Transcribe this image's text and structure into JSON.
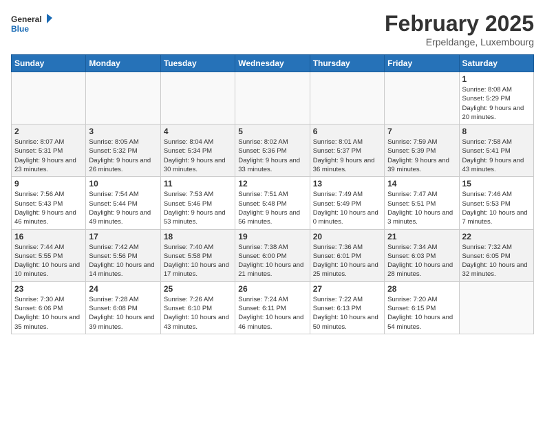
{
  "header": {
    "logo_general": "General",
    "logo_blue": "Blue",
    "month_title": "February 2025",
    "location": "Erpeldange, Luxembourg"
  },
  "weekdays": [
    "Sunday",
    "Monday",
    "Tuesday",
    "Wednesday",
    "Thursday",
    "Friday",
    "Saturday"
  ],
  "weeks": [
    [
      {
        "day": "",
        "info": ""
      },
      {
        "day": "",
        "info": ""
      },
      {
        "day": "",
        "info": ""
      },
      {
        "day": "",
        "info": ""
      },
      {
        "day": "",
        "info": ""
      },
      {
        "day": "",
        "info": ""
      },
      {
        "day": "1",
        "info": "Sunrise: 8:08 AM\nSunset: 5:29 PM\nDaylight: 9 hours and 20 minutes."
      }
    ],
    [
      {
        "day": "2",
        "info": "Sunrise: 8:07 AM\nSunset: 5:31 PM\nDaylight: 9 hours and 23 minutes."
      },
      {
        "day": "3",
        "info": "Sunrise: 8:05 AM\nSunset: 5:32 PM\nDaylight: 9 hours and 26 minutes."
      },
      {
        "day": "4",
        "info": "Sunrise: 8:04 AM\nSunset: 5:34 PM\nDaylight: 9 hours and 30 minutes."
      },
      {
        "day": "5",
        "info": "Sunrise: 8:02 AM\nSunset: 5:36 PM\nDaylight: 9 hours and 33 minutes."
      },
      {
        "day": "6",
        "info": "Sunrise: 8:01 AM\nSunset: 5:37 PM\nDaylight: 9 hours and 36 minutes."
      },
      {
        "day": "7",
        "info": "Sunrise: 7:59 AM\nSunset: 5:39 PM\nDaylight: 9 hours and 39 minutes."
      },
      {
        "day": "8",
        "info": "Sunrise: 7:58 AM\nSunset: 5:41 PM\nDaylight: 9 hours and 43 minutes."
      }
    ],
    [
      {
        "day": "9",
        "info": "Sunrise: 7:56 AM\nSunset: 5:43 PM\nDaylight: 9 hours and 46 minutes."
      },
      {
        "day": "10",
        "info": "Sunrise: 7:54 AM\nSunset: 5:44 PM\nDaylight: 9 hours and 49 minutes."
      },
      {
        "day": "11",
        "info": "Sunrise: 7:53 AM\nSunset: 5:46 PM\nDaylight: 9 hours and 53 minutes."
      },
      {
        "day": "12",
        "info": "Sunrise: 7:51 AM\nSunset: 5:48 PM\nDaylight: 9 hours and 56 minutes."
      },
      {
        "day": "13",
        "info": "Sunrise: 7:49 AM\nSunset: 5:49 PM\nDaylight: 10 hours and 0 minutes."
      },
      {
        "day": "14",
        "info": "Sunrise: 7:47 AM\nSunset: 5:51 PM\nDaylight: 10 hours and 3 minutes."
      },
      {
        "day": "15",
        "info": "Sunrise: 7:46 AM\nSunset: 5:53 PM\nDaylight: 10 hours and 7 minutes."
      }
    ],
    [
      {
        "day": "16",
        "info": "Sunrise: 7:44 AM\nSunset: 5:55 PM\nDaylight: 10 hours and 10 minutes."
      },
      {
        "day": "17",
        "info": "Sunrise: 7:42 AM\nSunset: 5:56 PM\nDaylight: 10 hours and 14 minutes."
      },
      {
        "day": "18",
        "info": "Sunrise: 7:40 AM\nSunset: 5:58 PM\nDaylight: 10 hours and 17 minutes."
      },
      {
        "day": "19",
        "info": "Sunrise: 7:38 AM\nSunset: 6:00 PM\nDaylight: 10 hours and 21 minutes."
      },
      {
        "day": "20",
        "info": "Sunrise: 7:36 AM\nSunset: 6:01 PM\nDaylight: 10 hours and 25 minutes."
      },
      {
        "day": "21",
        "info": "Sunrise: 7:34 AM\nSunset: 6:03 PM\nDaylight: 10 hours and 28 minutes."
      },
      {
        "day": "22",
        "info": "Sunrise: 7:32 AM\nSunset: 6:05 PM\nDaylight: 10 hours and 32 minutes."
      }
    ],
    [
      {
        "day": "23",
        "info": "Sunrise: 7:30 AM\nSunset: 6:06 PM\nDaylight: 10 hours and 35 minutes."
      },
      {
        "day": "24",
        "info": "Sunrise: 7:28 AM\nSunset: 6:08 PM\nDaylight: 10 hours and 39 minutes."
      },
      {
        "day": "25",
        "info": "Sunrise: 7:26 AM\nSunset: 6:10 PM\nDaylight: 10 hours and 43 minutes."
      },
      {
        "day": "26",
        "info": "Sunrise: 7:24 AM\nSunset: 6:11 PM\nDaylight: 10 hours and 46 minutes."
      },
      {
        "day": "27",
        "info": "Sunrise: 7:22 AM\nSunset: 6:13 PM\nDaylight: 10 hours and 50 minutes."
      },
      {
        "day": "28",
        "info": "Sunrise: 7:20 AM\nSunset: 6:15 PM\nDaylight: 10 hours and 54 minutes."
      },
      {
        "day": "",
        "info": ""
      }
    ]
  ]
}
